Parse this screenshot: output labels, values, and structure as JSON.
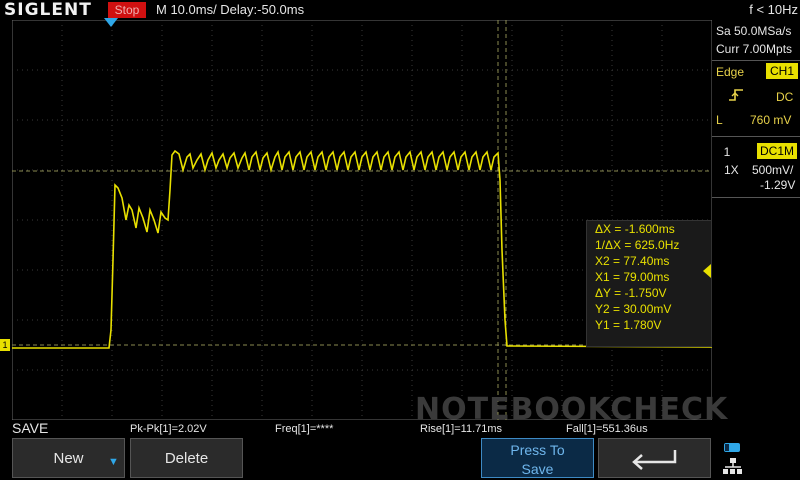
{
  "brand": "SIGLENT",
  "run_state": "Stop",
  "timebase": "M 10.0ms/ Delay:-50.0ms",
  "freq_counter": "f < 10Hz",
  "acquisition": {
    "sample_rate": "Sa 50.0MSa/s",
    "memory": "Curr 7.00Mpts"
  },
  "trigger": {
    "type": "Edge",
    "source": "CH1",
    "coupling": "DC",
    "level_label": "L",
    "level": "760 mV"
  },
  "channel": {
    "number": "1",
    "coupling": "DC1M",
    "probe": "1X",
    "scale": "500mV/",
    "offset": "-1.29V"
  },
  "cursors": [
    "ΔX = -1.600ms",
    "1/ΔX = 625.0Hz",
    "X2 = 77.40ms",
    "X1 = 79.00ms",
    "ΔY = -1.750V",
    "Y2 = 30.00mV",
    "Y1 = 1.780V"
  ],
  "channel_marker": "1",
  "menu_title": "SAVE",
  "measurements": {
    "pkpk": "Pk-Pk[1]=2.02V",
    "freq": "Freq[1]=****",
    "rise": "Rise[1]=11.71ms",
    "fall": "Fall[1]=551.36us"
  },
  "softkeys": {
    "new": "New",
    "delete": "Delete",
    "press_to_save_1": "Press To",
    "press_to_save_2": "Save"
  },
  "watermark": "NOTEBOOKCHECK",
  "colors": {
    "trace": "#e8e000",
    "accent": "#2fa7e8",
    "run_state": "#d01010"
  }
}
